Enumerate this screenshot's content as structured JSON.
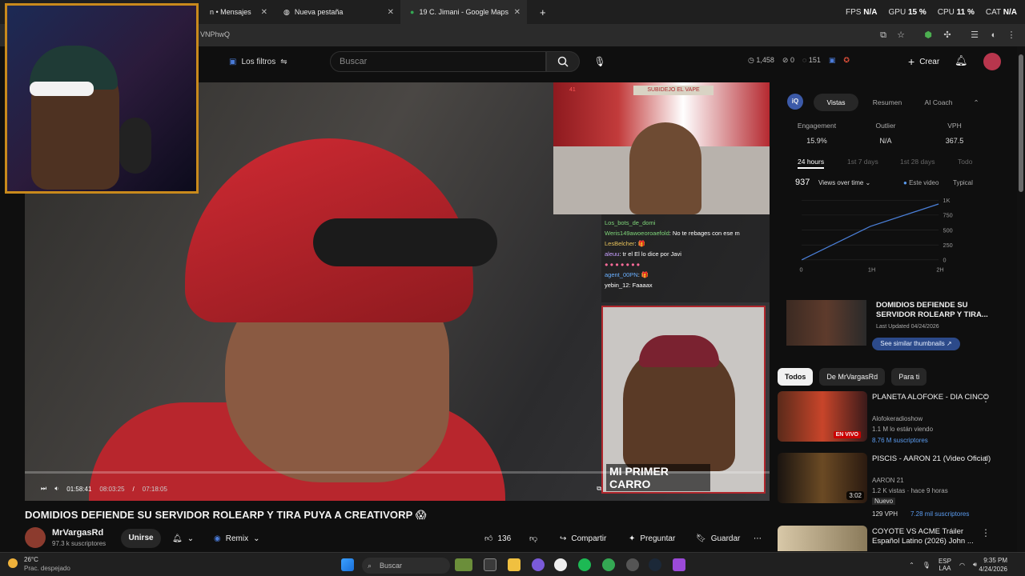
{
  "browser": {
    "tabs": [
      {
        "label": "n • Mensajes"
      },
      {
        "label": "Nueva pestaña"
      },
      {
        "label": "19 C. Jimani - Google Maps"
      }
    ],
    "new_tab": "+",
    "url": "VNPhwQ",
    "overlay_stats": {
      "fps_label": "FPS",
      "fps": "N/A",
      "gpu_label": "GPU",
      "gpu": "15 %",
      "cpu_label": "CPU",
      "cpu": "11 %",
      "cat_label": "CAT",
      "cat": "N/A"
    }
  },
  "header": {
    "filters_label": "Los filtros",
    "search_placeholder": "Buscar",
    "stats": {
      "views": "1,458",
      "likes": "0",
      "comments": "151"
    },
    "create_label": "Crear"
  },
  "video": {
    "title": "DOMIDIOS DEFIENDE SU SERVIDOR ROLEARP Y TIRA PUYA A CREATIVORP 😱",
    "progress": 0.0,
    "time_current": "01:58:41",
    "time_duration": "07:18:05",
    "time_overlay": "08:03:25",
    "inset_sign": "SUBIDEJO EL VAPE",
    "inset_badge": "41",
    "overlay_caption": "MI PRIMER CARRO",
    "chat": [
      {
        "nick": "Los_bots_de_domi",
        "msg": ""
      },
      {
        "nick": "Weris149awoeoroaefold",
        "msg": ": No te rebages con ese m"
      },
      {
        "nick": "LesBelcher",
        "msg": ": 🎁"
      },
      {
        "nick": "aleuu",
        "msg": ": tr el El lo dice por Javi"
      },
      {
        "nick": "",
        "msg": ""
      },
      {
        "nick": "agent_00PN",
        "msg": ": 🎁"
      },
      {
        "nick": "yebin_12",
        "msg": ": Faaaax"
      }
    ]
  },
  "channel": {
    "name": "MrVargasRd",
    "subs": "97.3 k suscriptores",
    "join_label": "Unirse",
    "remix_label": "Remix",
    "likes": "136",
    "share_label": "Compartir",
    "ask_label": "Preguntar",
    "save_label": "Guardar"
  },
  "panel": {
    "logo": "iQ",
    "tabs": [
      "Vistas",
      "Resumen",
      "AI Coach"
    ],
    "metrics": [
      {
        "label": "Engagement",
        "value": "15.9%"
      },
      {
        "label": "Outlier",
        "value": "N/A"
      },
      {
        "label": "VPH",
        "value": "367.5"
      }
    ],
    "periods": [
      "24 hours",
      "1st 7 days",
      "1st 28 days",
      "Todo"
    ],
    "total": "937",
    "view_select": "Views over time",
    "legend": [
      "Este video",
      "Typical"
    ],
    "yticks": [
      "1K",
      "750",
      "500",
      "250",
      "0"
    ],
    "xticks": [
      "0",
      "1H",
      "2H"
    ]
  },
  "chart_data": {
    "type": "line",
    "x": [
      "0",
      "1H",
      "2H"
    ],
    "series": [
      {
        "name": "Este video",
        "values": [
          0,
          560,
          937
        ]
      }
    ],
    "ylim": [
      0,
      1000
    ],
    "yticks": [
      "1K",
      "750",
      "500",
      "250",
      "0"
    ],
    "xticks": [
      "0",
      "1H",
      "2H"
    ]
  },
  "featured": {
    "title": "DOMIDIOS DEFIENDE SU SERVIDOR ROLEARP Y TIRA...",
    "date": "Last Updated 04/24/2026",
    "similar_label": "See similar thumbnails ↗"
  },
  "chips": [
    "Todos",
    "De MrVargasRd",
    "Para ti"
  ],
  "recs": [
    {
      "title": "PLANETA ALOFOKE - DIA CINCO",
      "channel": "Alofokeradioshow",
      "meta": "1.1 M lo están viendo",
      "extra": "8.76 M suscriptores",
      "badge": "EN VIVO"
    },
    {
      "title": "PISCIS - AARON 21 (Video Oficial)",
      "channel": "AARON 21",
      "meta": "1.2 K vistas · hace 9 horas",
      "extra": "Nuevo",
      "extra2": "129 VPH",
      "extra3": "7.28 mil suscriptores",
      "badge": "3:02"
    },
    {
      "title": "COYOTE VS ACME Tráiler Español Latino (2026) John ...",
      "channel": "",
      "meta": "",
      "extra": "",
      "badge": ""
    }
  ],
  "taskbar": {
    "temp": "26°C",
    "weather": "Prac. despejado",
    "search": "Buscar",
    "lang1": "ESP",
    "lang2": "LAA",
    "time": "9:35 PM",
    "date": "4/24/2026"
  },
  "colors": {
    "accent": "#3ea6ff",
    "progress": "#6cd43c",
    "brand_red": "#ff0000"
  }
}
